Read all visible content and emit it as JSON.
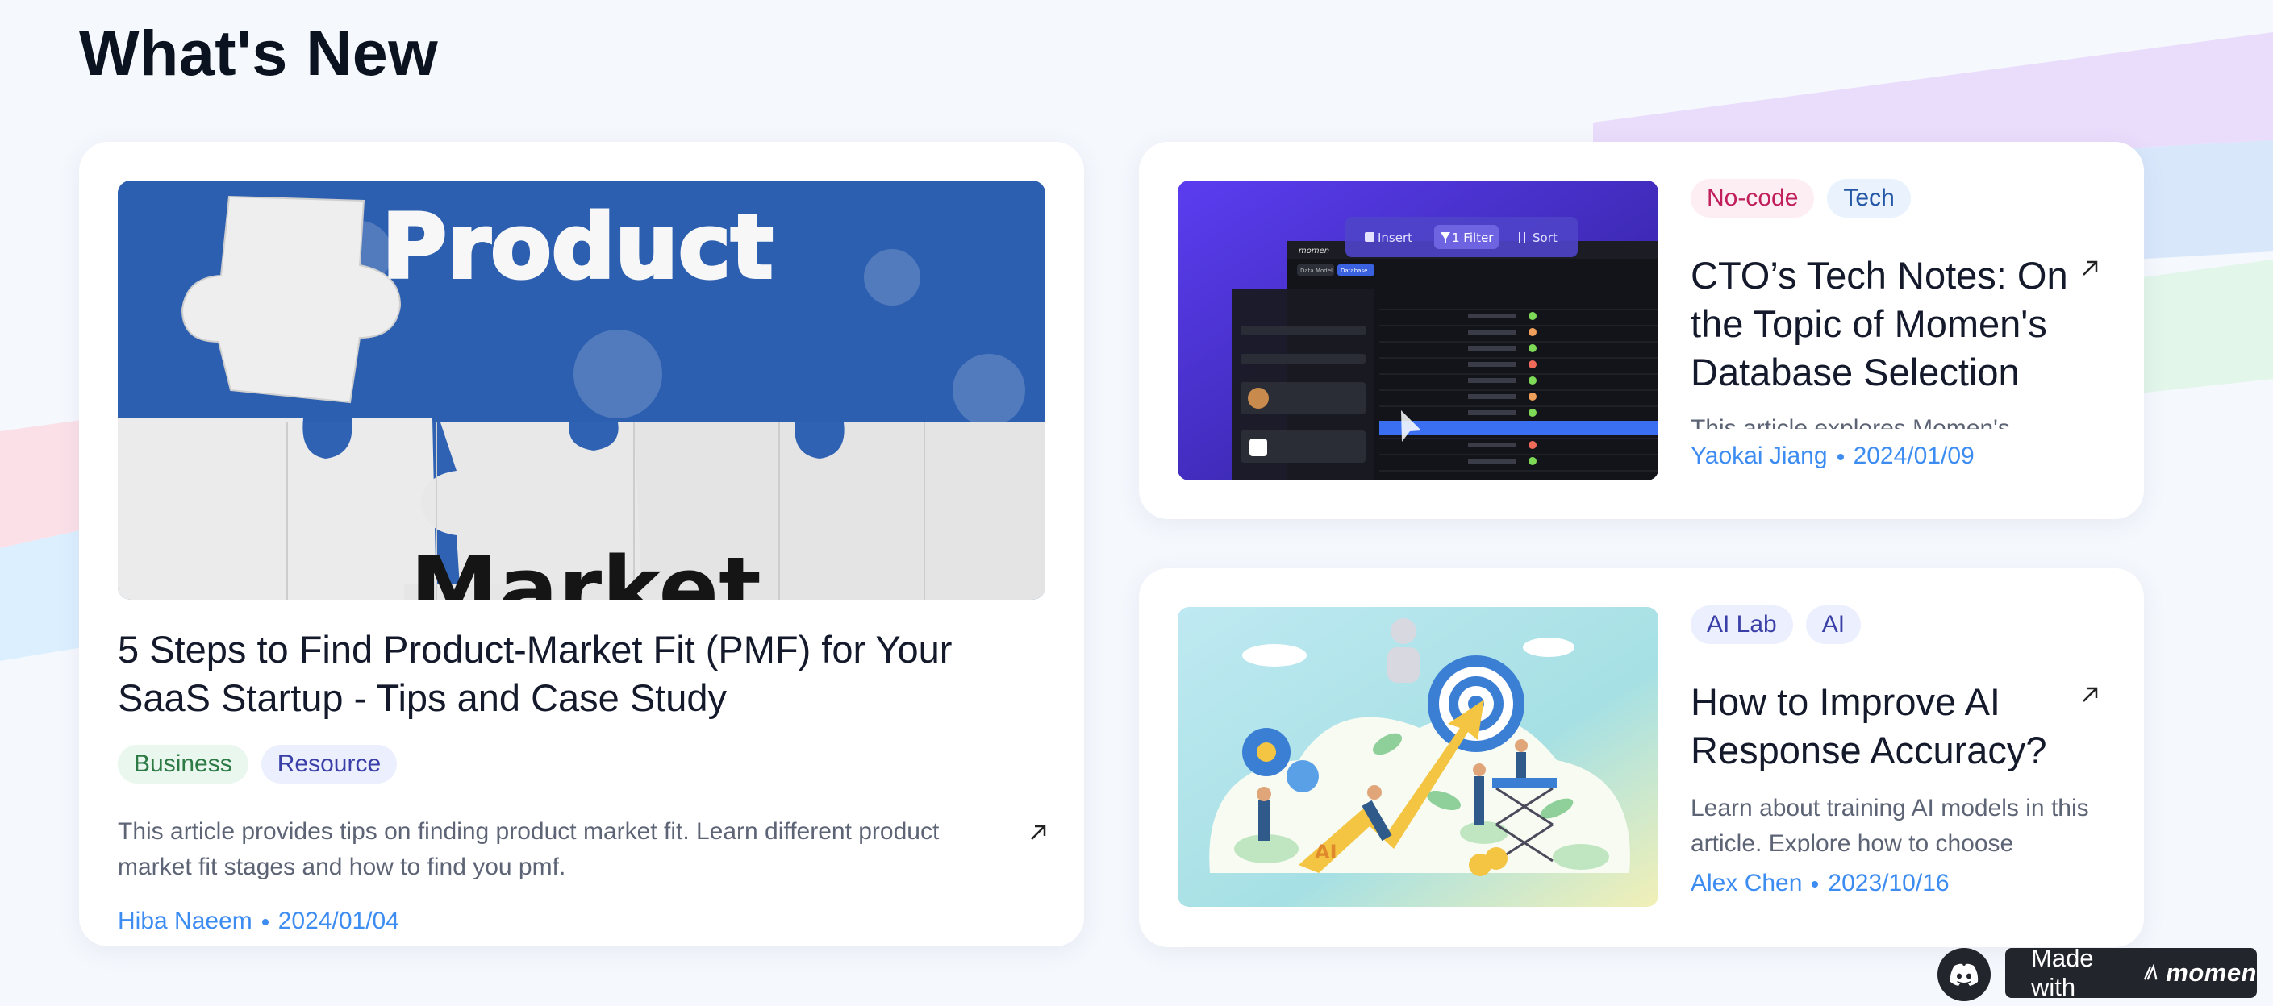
{
  "page": {
    "title": "What's New"
  },
  "featured": {
    "image_text_top": "Product",
    "image_text_bottom": "Market",
    "title": "5 Steps to Find Product-Market Fit (PMF) for Your SaaS Startup - Tips and Case Study",
    "tags": [
      "Business",
      "Resource"
    ],
    "description": "This article provides tips on finding product market fit. Learn different product market fit stages and how to find you pmf.",
    "author": "Hiba Naeem",
    "date": "2024/01/04"
  },
  "articles": [
    {
      "tags": [
        "No-code",
        "Tech"
      ],
      "title": "CTO’s Tech Notes: On the Topic of Momen's Database Selection",
      "description": "This article explores Momen's",
      "author": "Yaokai Jiang",
      "date": "2024/01/09",
      "thumb": {
        "toolbar": [
          "Insert",
          "1 Filter",
          "Sort"
        ],
        "tabs": [
          "Data Model",
          "Database"
        ],
        "brand": "momen"
      }
    },
    {
      "tags": [
        "AI Lab",
        "AI"
      ],
      "title": "How to Improve AI Response Accuracy?",
      "description": "Learn about training AI models in this article. Explore how to choose",
      "author": "Alex Chen",
      "date": "2023/10/16",
      "thumb": {
        "label": "AI"
      }
    }
  ],
  "footer": {
    "made_with": "Made with",
    "brand": "momen"
  },
  "colors": {
    "accent": "#3d8cf1",
    "background": "#f5f8fd",
    "stripe_pink": "#fbe3ea",
    "stripe_lavender": "#e9dcfb",
    "stripe_blue": "#d8e8fb",
    "stripe_green": "#e2f6ea"
  },
  "icons": [
    "arrow-up-right-icon",
    "discord-icon",
    "momen-logo-icon"
  ]
}
